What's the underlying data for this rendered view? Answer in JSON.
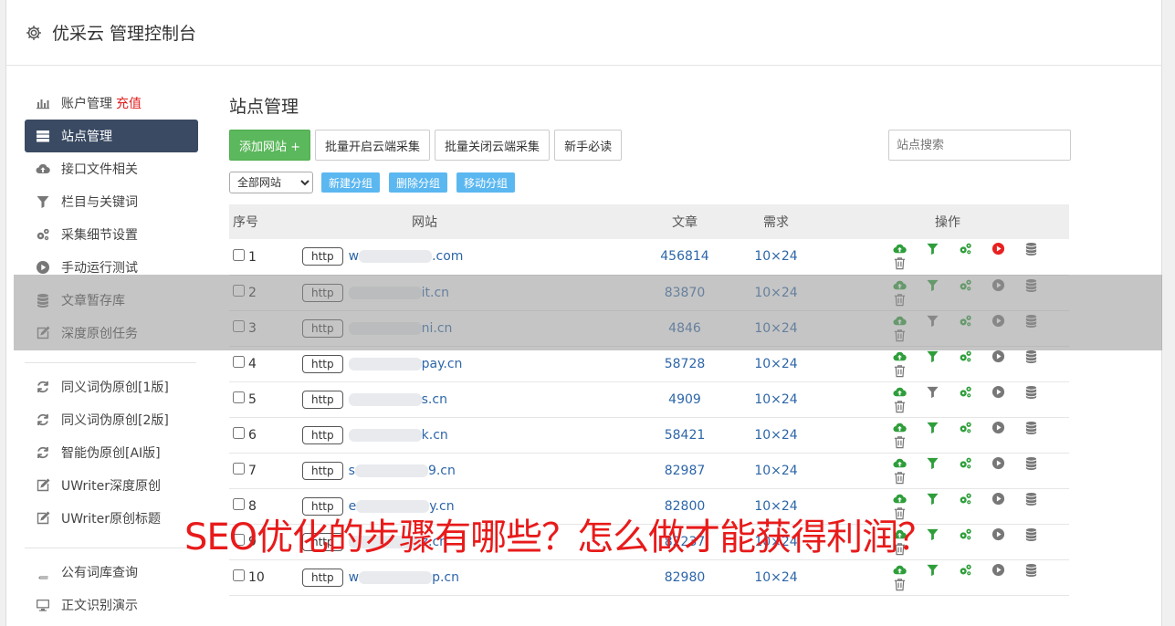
{
  "app": {
    "title": "优采云 管理控制台"
  },
  "sidebar": {
    "group1": [
      {
        "label": "账户管理",
        "badge": "充值",
        "icon": "bar-chart-icon",
        "active": false
      },
      {
        "label": "站点管理",
        "icon": "server-list-icon",
        "active": true
      },
      {
        "label": "接口文件相关",
        "icon": "cloud-upload-icon",
        "active": false
      },
      {
        "label": "栏目与关键词",
        "icon": "filter-icon",
        "active": false
      },
      {
        "label": "采集细节设置",
        "icon": "gears-icon",
        "active": false
      },
      {
        "label": "手动运行测试",
        "icon": "play-circle-icon",
        "active": false
      },
      {
        "label": "文章暂存库",
        "icon": "database-icon",
        "active": false
      },
      {
        "label": "深度原创任务",
        "icon": "edit-icon",
        "active": false
      }
    ],
    "group2": [
      {
        "label": "同义词伪原创[1版]",
        "icon": "refresh-icon"
      },
      {
        "label": "同义词伪原创[2版]",
        "icon": "refresh-icon"
      },
      {
        "label": "智能伪原创[AI版]",
        "icon": "refresh-icon"
      },
      {
        "label": "UWriter深度原创",
        "icon": "edit-icon"
      },
      {
        "label": "UWriter原创标题",
        "icon": "edit-icon"
      }
    ],
    "group3": [
      {
        "label": "公有词库查询",
        "icon": "book-icon"
      },
      {
        "label": "正文识别演示",
        "icon": "monitor-icon"
      }
    ]
  },
  "main": {
    "title": "站点管理",
    "toolbar": {
      "add_site": "添加网站 +",
      "batch_open": "批量开启云端采集",
      "batch_close": "批量关闭云端采集",
      "guide": "新手必读",
      "search_placeholder": "站点搜索"
    },
    "group_bar": {
      "select_value": "全部网站",
      "new_group": "新建分组",
      "delete_group": "删除分组",
      "move_group": "移动分组"
    },
    "table": {
      "headers": {
        "idx": "序号",
        "site": "网站",
        "articles": "文章",
        "demand": "需求",
        "ops": "操作"
      },
      "rows": [
        {
          "idx": "1",
          "prefix": "w",
          "tail": ".com",
          "articles": "456814",
          "demand": "10×24",
          "play_red": true,
          "filter_green": true
        },
        {
          "idx": "2",
          "prefix": "",
          "tail": "it.cn",
          "articles": "83870",
          "demand": "10×24",
          "play_red": false,
          "filter_green": true
        },
        {
          "idx": "3",
          "prefix": "",
          "tail": "ni.cn",
          "articles": "4846",
          "demand": "10×24",
          "play_red": false,
          "filter_green": false
        },
        {
          "idx": "4",
          "prefix": "",
          "tail": "pay.cn",
          "articles": "58728",
          "demand": "10×24",
          "play_red": false,
          "filter_green": true
        },
        {
          "idx": "5",
          "prefix": "",
          "tail": "s.cn",
          "articles": "4909",
          "demand": "10×24",
          "play_red": false,
          "filter_green": false
        },
        {
          "idx": "6",
          "prefix": "",
          "tail": "k.cn",
          "articles": "58421",
          "demand": "10×24",
          "play_red": false,
          "filter_green": true
        },
        {
          "idx": "7",
          "prefix": "s",
          "tail": "9.cn",
          "articles": "82987",
          "demand": "10×24",
          "play_red": false,
          "filter_green": true
        },
        {
          "idx": "8",
          "prefix": "e",
          "tail": "y.cn",
          "articles": "82800",
          "demand": "10×24",
          "play_red": false,
          "filter_green": true
        },
        {
          "idx": "9",
          "prefix": "",
          "tail": "z.cn",
          "articles": "82237",
          "demand": "10×24",
          "play_red": false,
          "filter_green": true
        },
        {
          "idx": "10",
          "prefix": "w",
          "tail": "p.cn",
          "articles": "82980",
          "demand": "10×24",
          "play_red": false,
          "filter_green": true
        }
      ]
    },
    "http_label": "http"
  },
  "overlay_caption": "SEO优化的步骤有哪些？怎么做才能获得利润？",
  "colors": {
    "green": "#5cb85c",
    "link_blue": "#2d66a8",
    "sidebar_active": "#3a4a63",
    "caption_red": "#e81a1a",
    "light_btn": "#5bb7f0"
  }
}
